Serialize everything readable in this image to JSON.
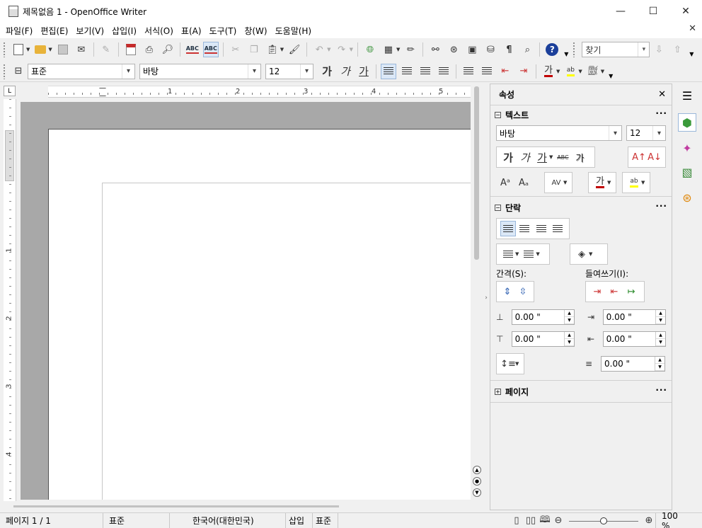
{
  "window": {
    "title": "제목없음 1 - OpenOffice Writer",
    "minimize": "—",
    "maximize": "☐",
    "close": "✕"
  },
  "menu": {
    "items": [
      "파일(F)",
      "편집(E)",
      "보기(V)",
      "삽입(I)",
      "서식(O)",
      "표(A)",
      "도구(T)",
      "창(W)",
      "도움말(H)"
    ],
    "close": "✕"
  },
  "toolbar": {
    "find": {
      "value": "찾기",
      "arrow": "▾"
    },
    "help": "?",
    "binoculars": "🔍"
  },
  "format_bar": {
    "style": "표준",
    "font": "바탕",
    "size": "12",
    "bold": "가",
    "italic": "가",
    "underline": "가",
    "font_color": "가",
    "highlight": "ab"
  },
  "ruler": {
    "h_numbers": [
      "1",
      "2",
      "3",
      "4",
      "5"
    ],
    "v_numbers": [
      "1",
      "2",
      "3",
      "4"
    ],
    "corner": "L"
  },
  "sidebar": {
    "title": "속성",
    "close": "✕",
    "text_section": {
      "title": "텍스트",
      "font": "바탕",
      "size": "12",
      "bold": "가",
      "italic": "가",
      "underline": "가",
      "strike": "ABC",
      "shadow": "가",
      "font_color": "가",
      "highlight": "ab"
    },
    "para_section": {
      "title": "단락",
      "spacing_label": "간격(S):",
      "indent_label": "들여쓰기(I):",
      "above": "0.00 \"",
      "below": "0.00 \"",
      "before": "0.00 \"",
      "after": "0.00 \"",
      "first_line": "0.00 \""
    },
    "page_section": {
      "title": "페이지"
    },
    "more": "···"
  },
  "statusbar": {
    "page": "페이지 1 / 1",
    "style": "표준",
    "language": "한국어(대한민국)",
    "insert_mode": "삽입",
    "selection_mode": "표준",
    "zoom": "100 %",
    "zoom_level": 0.5
  },
  "colors": {
    "font_color": "#c00000",
    "highlight": "#ffff00",
    "accent": "#dbe8f7"
  }
}
